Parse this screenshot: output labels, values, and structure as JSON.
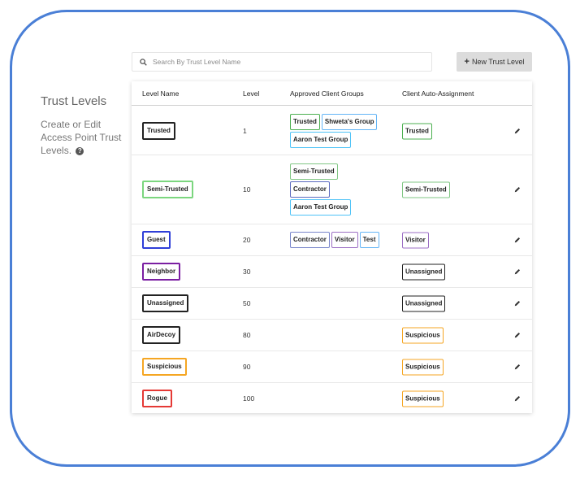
{
  "sidebar": {
    "title": "Trust Levels",
    "description": "Create or Edit Access Point Trust Levels.",
    "help_icon": "question-circle-icon"
  },
  "search": {
    "placeholder": "Search By Trust Level Name",
    "value": "",
    "icon": "search-icon"
  },
  "toolbar": {
    "new_label": "New Trust Level",
    "new_icon": "plus-icon"
  },
  "table": {
    "columns": [
      "Level Name",
      "Level",
      "Approved Client Groups",
      "Client Auto-Assignment"
    ],
    "rows": [
      {
        "name": "Trusted",
        "name_color": "#222222",
        "level": "1",
        "groups": [
          {
            "label": "Trusted",
            "color": "#4caf50"
          },
          {
            "label": "Shweta's Group",
            "color": "#64b5f6"
          },
          {
            "label": "Aaron Test Group",
            "color": "#4fc3f7"
          }
        ],
        "auto": {
          "label": "Trusted",
          "color": "#4caf50"
        }
      },
      {
        "name": "Semi-Trusted",
        "name_color": "#7bd67e",
        "level": "10",
        "groups": [
          {
            "label": "Semi-Trusted",
            "color": "#81c784"
          },
          {
            "label": "Contractor",
            "color": "#5c6bc0"
          },
          {
            "label": "Aaron Test Group",
            "color": "#4fc3f7"
          }
        ],
        "auto": {
          "label": "Semi-Trusted",
          "color": "#81c784"
        }
      },
      {
        "name": "Guest",
        "name_color": "#2f3fd8",
        "level": "20",
        "groups": [
          {
            "label": "Contractor",
            "color": "#7986cb"
          },
          {
            "label": "Visitor",
            "color": "#9c6fc4"
          },
          {
            "label": "Test",
            "color": "#64b5f6"
          }
        ],
        "auto": {
          "label": "Visitor",
          "color": "#9c6fc4"
        }
      },
      {
        "name": "Neighbor",
        "name_color": "#7b1fa2",
        "level": "30",
        "groups": [],
        "auto": {
          "label": "Unassigned",
          "color": "#222222"
        }
      },
      {
        "name": "Unassigned",
        "name_color": "#222222",
        "level": "50",
        "groups": [],
        "auto": {
          "label": "Unassigned",
          "color": "#222222"
        }
      },
      {
        "name": "AirDecoy",
        "name_color": "#222222",
        "level": "80",
        "groups": [],
        "auto": {
          "label": "Suspicious",
          "color": "#f5a623"
        }
      },
      {
        "name": "Suspicious",
        "name_color": "#f5a623",
        "level": "90",
        "groups": [],
        "auto": {
          "label": "Suspicious",
          "color": "#f5a623"
        }
      },
      {
        "name": "Rogue",
        "name_color": "#e53935",
        "level": "100",
        "groups": [],
        "auto": {
          "label": "Suspicious",
          "color": "#f5a623"
        }
      }
    ],
    "edit_icon": "pencil-icon"
  }
}
